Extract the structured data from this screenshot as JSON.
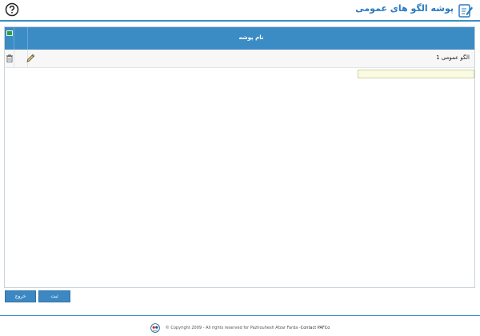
{
  "header": {
    "title": "پوشه الگو های عمومی"
  },
  "grid": {
    "column_title": "نام پوشه",
    "rows": [
      {
        "name": "الگو عمومی 1"
      }
    ],
    "filter_value": ""
  },
  "buttons": {
    "save": "ثبت",
    "exit": "خروج"
  },
  "footer": {
    "copyright": "© Copyright 2009 - All rights reserved for Pazhouhesh Afzar Farda - ",
    "contact": "Contact PAFCo"
  },
  "colors": {
    "accent": "#3b8bc4",
    "title": "#2a7bbf",
    "filter_bg": "#fbfbe4"
  }
}
